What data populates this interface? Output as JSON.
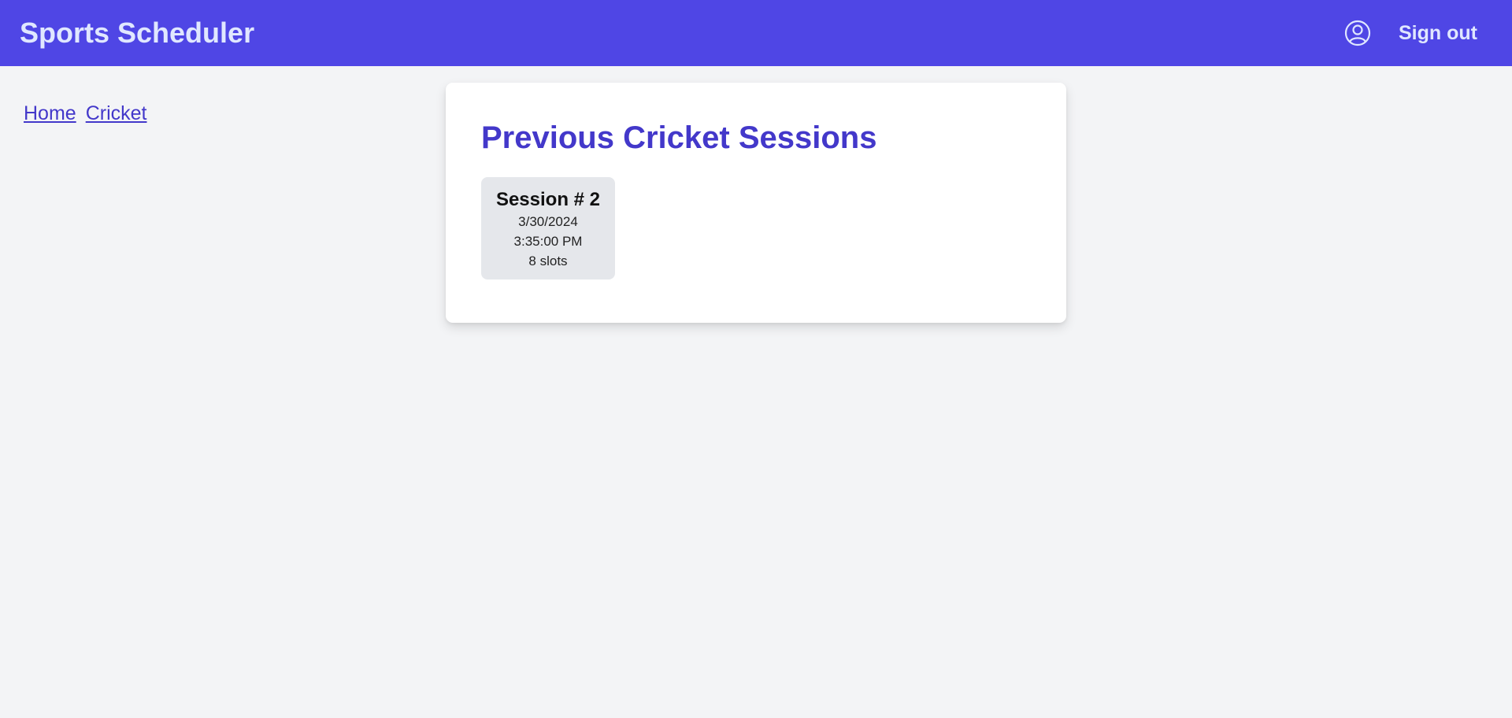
{
  "navbar": {
    "brand": "Sports Scheduler",
    "user_icon": "user-circle-icon",
    "signout_label": "Sign out",
    "background": "#4f46e5"
  },
  "breadcrumb": {
    "items": [
      {
        "label": "Home"
      },
      {
        "label": "Cricket"
      }
    ]
  },
  "main": {
    "title": "Previous Cricket Sessions",
    "sessions": [
      {
        "name": "Session # 2",
        "date": "3/30/2024",
        "time": "3:35:00 PM",
        "slots": "8 slots"
      }
    ]
  }
}
